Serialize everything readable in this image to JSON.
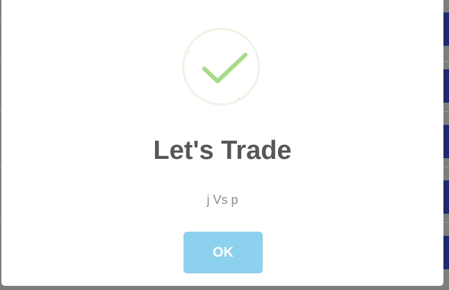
{
  "modal": {
    "icon": "success-checkmark-icon",
    "title": "Let's Trade",
    "message": "j Vs p",
    "confirm_label": "OK"
  },
  "colors": {
    "check": "#a5dc86",
    "ring": "#eaf6e3",
    "button": "#8cd2ee",
    "title": "#575757",
    "message": "#8d8d8d"
  }
}
